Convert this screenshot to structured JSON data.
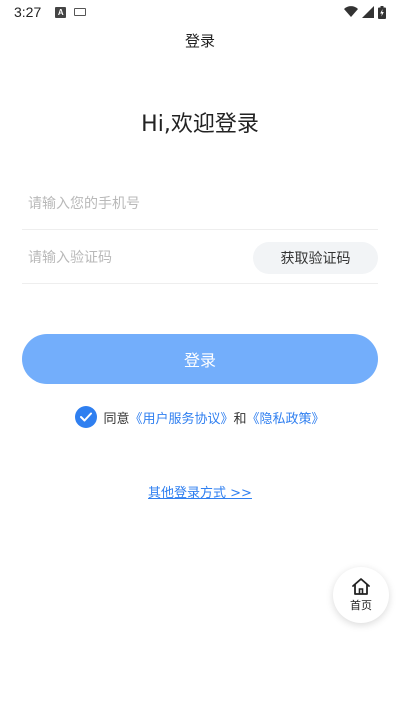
{
  "status_bar": {
    "time": "3:27",
    "a_badge": "A"
  },
  "header": {
    "title": "登录"
  },
  "welcome": "Hi,欢迎登录",
  "form": {
    "phone_placeholder": "请输入您的手机号",
    "code_placeholder": "请输入验证码",
    "get_code_label": "获取验证码"
  },
  "login_button": "登录",
  "agreement": {
    "agree_text": "同意",
    "service_link": "《用户服务协议》",
    "and_text": "和",
    "privacy_link": "《隐私政策》",
    "checked": true
  },
  "other_login": "其他登录方式 >>",
  "home_fab": {
    "label": "首页"
  },
  "colors": {
    "accent": "#2f7ff0",
    "login_button": "#73aefb"
  }
}
